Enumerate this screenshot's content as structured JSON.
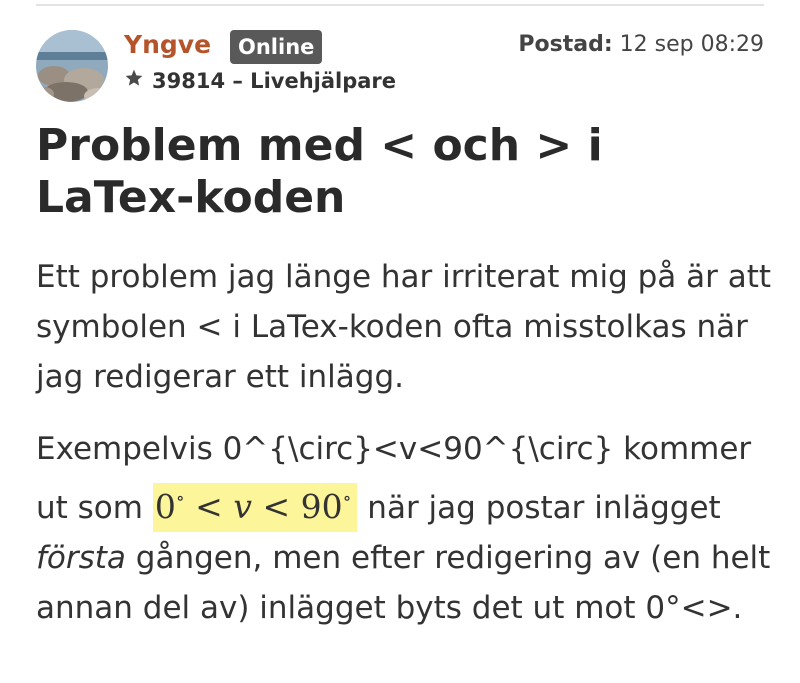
{
  "post": {
    "author": "Yngve",
    "status": "Online",
    "posted_label": "Postad:",
    "posted_time": "12 sep 08:29",
    "rank_text": "39814 – Livehjälpare",
    "title": "Problem med < och > i LaTex-koden"
  },
  "body": {
    "para1": "Ett problem jag länge har irriterat mig på är att symbolen < i LaTex-koden ofta misstolkas när jag redigerar ett inlägg.",
    "para2_start": "Exempelvis 0^{\\circ}<v<90^{\\circ} kommer ut som ",
    "math_zero": "0",
    "math_deg": "∘",
    "math_lt": "<",
    "math_var": "v",
    "math_ninety": "90",
    "para2_mid": " när jag postar inlägget ",
    "para2_em": "första",
    "para2_end": " gången, men efter redigering av (en helt annan del av) inlägget byts det ut mot 0°<>."
  },
  "icons": {
    "rank": "star-icon",
    "avatar": "avatar-photo"
  },
  "colors": {
    "author": "#b5542a",
    "badge": "#595959",
    "highlight": "#fdf59a"
  }
}
